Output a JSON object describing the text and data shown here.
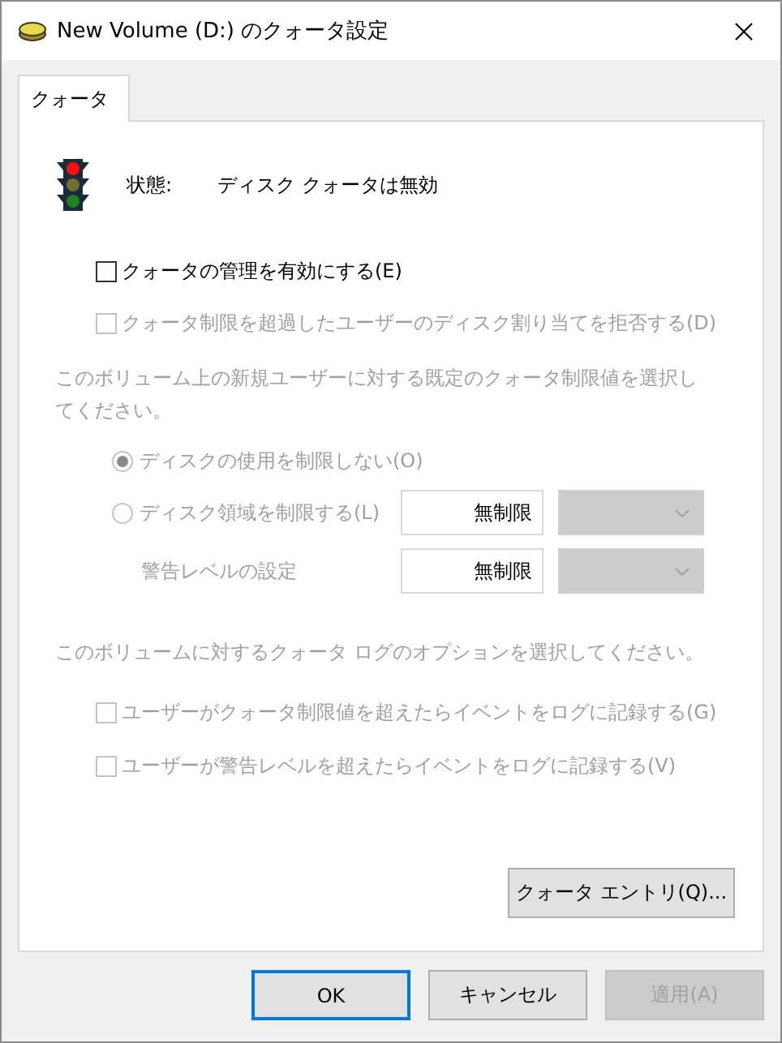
{
  "window": {
    "title": "New Volume (D:) のクォータ設定"
  },
  "tabs": [
    {
      "label": "クォータ",
      "selected": true
    }
  ],
  "status": {
    "label": "状態:",
    "value": "ディスク クォータは無効"
  },
  "options": [
    {
      "label": "クォータの管理を有効にする(E)",
      "checked": false,
      "disabled": false
    },
    {
      "label": "クォータ制限を超過したユーザーのディスク割り当てを拒否する(D)",
      "checked": false,
      "disabled": true
    }
  ],
  "limit_prompt": "このボリューム上の新規ユーザーに対する既定のクォータ制限値を選択してください。",
  "limit_choices": [
    {
      "kind": "plain",
      "label": "ディスクの使用を制限しない(O)",
      "selected": true,
      "disabled": true
    },
    {
      "kind": "amount",
      "label": "ディスク領域を制限する(L)",
      "selected": false,
      "disabled": true,
      "value": "無制限"
    }
  ],
  "warning": {
    "label": "警告レベルの設定",
    "value": "無制限"
  },
  "log_prompt": "このボリュームに対するクォータ ログのオプションを選択してください。",
  "log_options": [
    {
      "label": "ユーザーがクォータ制限値を超えたらイベントをログに記録する(G)",
      "checked": false,
      "disabled": true
    },
    {
      "label": "ユーザーが警告レベルを超えたらイベントをログに記録する(V)",
      "checked": false,
      "disabled": true
    }
  ],
  "entries_button": "クォータ エントリ(Q)...",
  "buttons": [
    {
      "label": "OK",
      "default": true,
      "disabled": false
    },
    {
      "label": "キャンセル",
      "default": false,
      "disabled": false
    },
    {
      "label": "適用(A)",
      "default": false,
      "disabled": true
    }
  ]
}
